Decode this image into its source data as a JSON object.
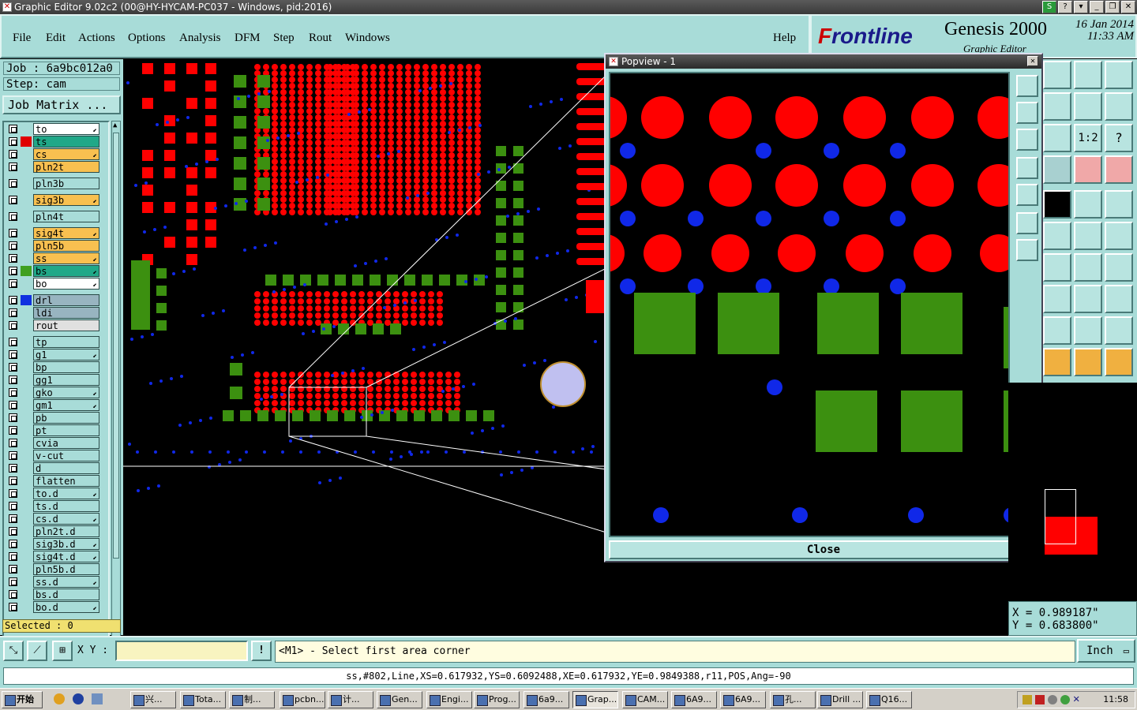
{
  "window": {
    "title": "Graphic Editor 9.02c2 (00@HY-HYCAM-PC037 - Windows, pid:2016)"
  },
  "menu": {
    "file": "File",
    "edit": "Edit",
    "actions": "Actions",
    "options": "Options",
    "analysis": "Analysis",
    "dfm": "DFM",
    "step": "Step",
    "rout": "Rout",
    "windows": "Windows",
    "help": "Help"
  },
  "brand": {
    "logo": "Frontline",
    "product": "Genesis 2000",
    "subtitle": "Graphic Editor",
    "date": "16 Jan 2014",
    "time": "11:33 AM"
  },
  "job": {
    "job_label": "Job : 6a9bc012a0",
    "step_label": "Step: cam",
    "matrix_button": "Job Matrix ..."
  },
  "layers": [
    {
      "name": "to",
      "color": "#ffffff",
      "swatch": "",
      "edit": true
    },
    {
      "name": "ts",
      "color": "#20a888",
      "swatch": "#e00000",
      "edit": false
    },
    {
      "name": "cs",
      "color": "#f8c050",
      "swatch": "",
      "edit": true
    },
    {
      "name": "pln2t",
      "color": "#f8c050",
      "swatch": "",
      "edit": false
    },
    {
      "name": "pln3b",
      "color": "#a8dcd8",
      "swatch": "",
      "edit": false
    },
    {
      "name": "sig3b",
      "color": "#f8c050",
      "swatch": "",
      "edit": true
    },
    {
      "name": "pln4t",
      "color": "#a8dcd8",
      "swatch": "",
      "edit": false
    },
    {
      "name": "sig4t",
      "color": "#f8c050",
      "swatch": "",
      "edit": true
    },
    {
      "name": "pln5b",
      "color": "#f8c050",
      "swatch": "",
      "edit": false
    },
    {
      "name": "ss",
      "color": "#f8c050",
      "swatch": "",
      "edit": true
    },
    {
      "name": "bs",
      "color": "#20a888",
      "swatch": "#40a020",
      "edit": true
    },
    {
      "name": "bo",
      "color": "#ffffff",
      "swatch": "",
      "edit": true
    },
    {
      "name": "drl",
      "color": "#98b4c0",
      "swatch": "#1030e0",
      "edit": false
    },
    {
      "name": "ldi",
      "color": "#98b4c0",
      "swatch": "",
      "edit": false
    },
    {
      "name": "rout",
      "color": "#e0e0e0",
      "swatch": "",
      "edit": false
    },
    {
      "name": "tp",
      "color": "#a8dcd8",
      "swatch": "",
      "edit": false
    },
    {
      "name": "g1",
      "color": "#a8dcd8",
      "swatch": "",
      "edit": true
    },
    {
      "name": "bp",
      "color": "#a8dcd8",
      "swatch": "",
      "edit": false
    },
    {
      "name": "gg1",
      "color": "#a8dcd8",
      "swatch": "",
      "edit": false
    },
    {
      "name": "gko",
      "color": "#a8dcd8",
      "swatch": "",
      "edit": true
    },
    {
      "name": "gm1",
      "color": "#a8dcd8",
      "swatch": "",
      "edit": true
    },
    {
      "name": "pb",
      "color": "#a8dcd8",
      "swatch": "",
      "edit": false
    },
    {
      "name": "pt",
      "color": "#a8dcd8",
      "swatch": "",
      "edit": false
    },
    {
      "name": "cvia",
      "color": "#a8dcd8",
      "swatch": "",
      "edit": false
    },
    {
      "name": "v-cut",
      "color": "#a8dcd8",
      "swatch": "",
      "edit": false
    },
    {
      "name": "d",
      "color": "#a8dcd8",
      "swatch": "",
      "edit": false
    },
    {
      "name": "flatten",
      "color": "#a8dcd8",
      "swatch": "",
      "edit": false
    },
    {
      "name": "to.d",
      "color": "#a8dcd8",
      "swatch": "",
      "edit": true
    },
    {
      "name": "ts.d",
      "color": "#a8dcd8",
      "swatch": "",
      "edit": false
    },
    {
      "name": "cs.d",
      "color": "#a8dcd8",
      "swatch": "",
      "edit": true
    },
    {
      "name": "pln2t.d",
      "color": "#a8dcd8",
      "swatch": "",
      "edit": false
    },
    {
      "name": "sig3b.d",
      "color": "#a8dcd8",
      "swatch": "",
      "edit": true
    },
    {
      "name": "sig4t.d",
      "color": "#a8dcd8",
      "swatch": "",
      "edit": true
    },
    {
      "name": "pln5b.d",
      "color": "#a8dcd8",
      "swatch": "",
      "edit": false
    },
    {
      "name": "ss.d",
      "color": "#a8dcd8",
      "swatch": "",
      "edit": true
    },
    {
      "name": "bs.d",
      "color": "#a8dcd8",
      "swatch": "",
      "edit": false
    },
    {
      "name": "bo.d",
      "color": "#a8dcd8",
      "swatch": "",
      "edit": true
    }
  ],
  "selected": "Selected : 0",
  "popview": {
    "title": "Popview - 1",
    "close_button": "Close"
  },
  "coords": {
    "x": "X = 0.989187\"",
    "y": "Y = 0.683800\""
  },
  "bottom": {
    "xy_label": "X Y :",
    "xy_value": "",
    "prompt": "<M1> - Select first area corner",
    "unit": "Inch"
  },
  "info": "ss,#802,Line,XS=0.617932,YS=0.6092488,XE=0.617932,YE=0.9849388,r11,POS,Ang=-90",
  "taskbar": {
    "start": "开始",
    "items": [
      "兴...",
      "Tota...",
      "制...",
      "pcbn...",
      "计...",
      "Gen...",
      "Engi...",
      "Prog...",
      "6a9...",
      "Grap...",
      "CAM...",
      "6A9...",
      "6A9...",
      "孔...",
      "Drill ...",
      "Q16..."
    ],
    "active": "Grap...",
    "clock": "11:58"
  },
  "colors": {
    "panel": "#a8dcd8",
    "pad_red": "#ff0000",
    "pad_green": "#3c9010",
    "via_blue": "#1028e8"
  }
}
